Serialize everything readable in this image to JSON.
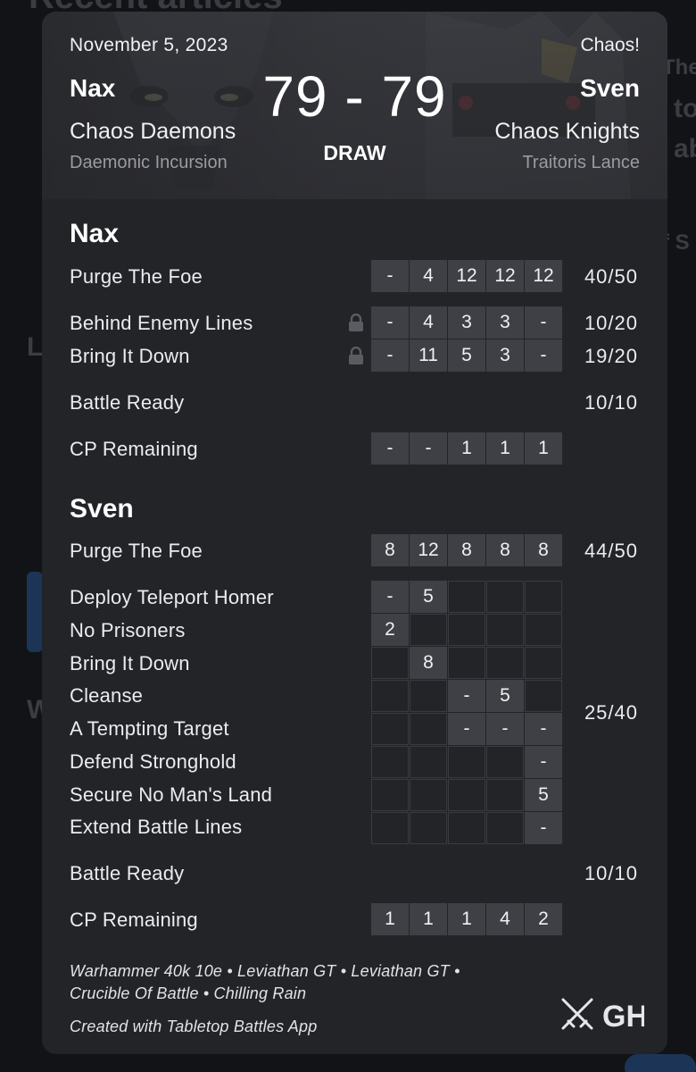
{
  "background": {
    "heading": "Recent articles"
  },
  "header": {
    "date": "November 5, 2023",
    "tag": "Chaos!",
    "score": "79 - 79",
    "result": "DRAW",
    "player1": {
      "name": "Nax",
      "faction": "Chaos Daemons",
      "detachment": "Daemonic Incursion"
    },
    "player2": {
      "name": "Sven",
      "faction": "Chaos Knights",
      "detachment": "Traitoris Lance"
    }
  },
  "sections": [
    {
      "player": "Nax",
      "primary": {
        "label": "Purge The Foe",
        "rounds": [
          "-",
          "4",
          "12",
          "12",
          "12"
        ],
        "total": "40/50"
      },
      "secondaries": [
        {
          "label": "Behind Enemy Lines",
          "locked": true,
          "rounds": [
            "-",
            "4",
            "3",
            "3",
            "-"
          ],
          "total": "10/20"
        },
        {
          "label": "Bring It Down",
          "locked": true,
          "rounds": [
            "-",
            "11",
            "5",
            "3",
            "-"
          ],
          "total": "19/20"
        }
      ],
      "battle_ready": {
        "label": "Battle Ready",
        "total": "10/10"
      },
      "cp": {
        "label": "CP Remaining",
        "rounds": [
          "-",
          "-",
          "1",
          "1",
          "1"
        ]
      }
    },
    {
      "player": "Sven",
      "primary": {
        "label": "Purge The Foe",
        "rounds": [
          "8",
          "12",
          "8",
          "8",
          "8"
        ],
        "total": "44/50"
      },
      "secondaries": [
        {
          "label": "Deploy Teleport Homer",
          "rounds": [
            "-",
            "5",
            "",
            "",
            ""
          ]
        },
        {
          "label": "No Prisoners",
          "rounds": [
            "2",
            "",
            "",
            "",
            ""
          ]
        },
        {
          "label": "Bring It Down",
          "rounds": [
            "",
            "8",
            "",
            "",
            ""
          ]
        },
        {
          "label": "Cleanse",
          "rounds": [
            "",
            "",
            "-",
            "5",
            ""
          ]
        },
        {
          "label": "A Tempting Target",
          "rounds": [
            "",
            "",
            "-",
            "-",
            "-"
          ]
        },
        {
          "label": "Defend Stronghold",
          "rounds": [
            "",
            "",
            "",
            "",
            "-"
          ]
        },
        {
          "label": "Secure No Man's Land",
          "rounds": [
            "",
            "",
            "",
            "",
            "5"
          ]
        },
        {
          "label": "Extend Battle Lines",
          "rounds": [
            "",
            "",
            "",
            "",
            "-"
          ]
        }
      ],
      "secondary_total": "25/40",
      "battle_ready": {
        "label": "Battle Ready",
        "total": "10/10"
      },
      "cp": {
        "label": "CP Remaining",
        "rounds": [
          "1",
          "1",
          "1",
          "4",
          "2"
        ]
      }
    }
  ],
  "footer": {
    "line1": "Warhammer 40k 10e • Leviathan GT • Leviathan GT •",
    "line2": "Crucible Of Battle • Chilling Rain",
    "credit": "Created with Tabletop Battles App",
    "logo_text": "GH"
  },
  "icons": {
    "lock": "lock-icon",
    "logo": "crossed-swords-icon"
  }
}
